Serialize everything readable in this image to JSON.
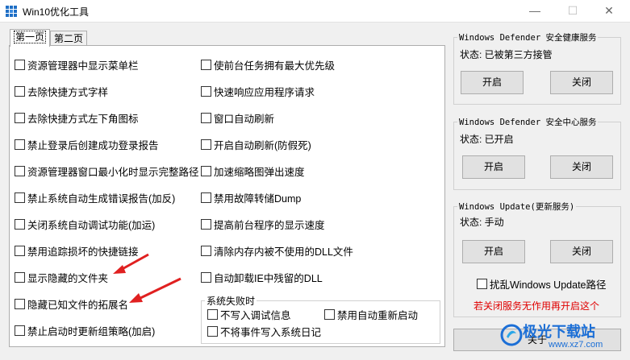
{
  "window": {
    "title": "Win10优化工具",
    "minimize": "—",
    "maximize": "☐",
    "close": "✕"
  },
  "tabs": [
    {
      "label": "第一页",
      "active": true
    },
    {
      "label": "第二页",
      "active": false
    }
  ],
  "left_options": [
    "资源管理器中显示菜单栏",
    "去除快捷方式字样",
    "去除快捷方式左下角图标",
    "禁止登录后创建成功登录报告",
    "资源管理器窗口最小化时显示完整路径",
    "禁止系统自动生成错误报告(加反)",
    "关闭系统自动调试功能(加运)",
    "禁用追踪损坏的快捷链接",
    "显示隐藏的文件夹",
    "隐藏已知文件的拓展名",
    "禁止启动时更新组策略(加启)"
  ],
  "right_options": [
    "使前台任务拥有最大优先级",
    "快速响应应用程序请求",
    "窗口自动刷新",
    "开启自动刷新(防假死)",
    "加速缩略图弹出速度",
    "禁用故障转储Dump",
    "提高前台程序的显示速度",
    "清除内存内被不使用的DLL文件",
    "自动卸载IE中残留的DLL"
  ],
  "failure_group": {
    "title": "系统失败时",
    "options": [
      "不写入调试信息",
      "禁用自动重新启动",
      "不将事件写入系统日记"
    ]
  },
  "services": [
    {
      "title": "Windows Defender 安全健康服务",
      "status": "状态: 已被第三方接管",
      "enable": "开启",
      "disable": "关闭"
    },
    {
      "title": "Windows Defender 安全中心服务",
      "status": "状态: 已开启",
      "enable": "开启",
      "disable": "关闭"
    },
    {
      "title": "Windows Update(更新服务)",
      "status": "状态: 手动",
      "enable": "开启",
      "disable": "关闭"
    }
  ],
  "update_path_option": "扰乱Windows Update路径",
  "red_note": "若关闭服务无作用再开启这个",
  "about_label": "关于",
  "watermark": {
    "line1": "极光下载站",
    "line2": "www.xz7.com"
  },
  "colors": {
    "note_red": "#e00000",
    "arrow_red": "#e02020",
    "watermark_blue": "#1c6fd6"
  }
}
